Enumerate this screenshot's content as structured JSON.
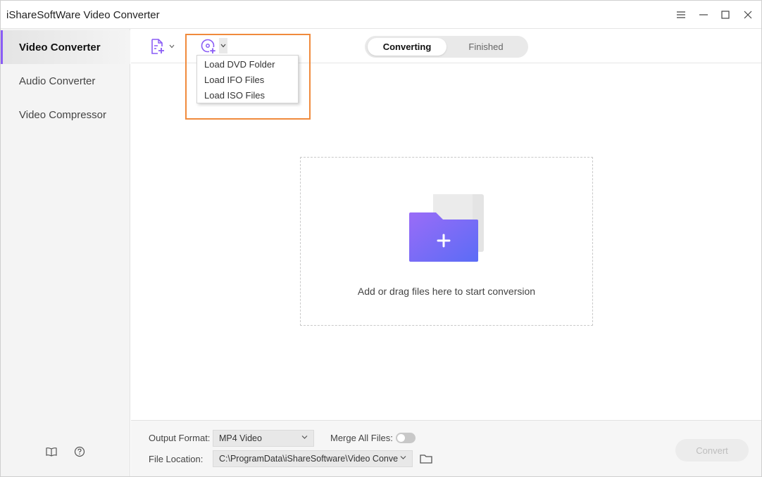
{
  "window": {
    "title": "iShareSoftWare Video Converter",
    "controls": [
      "menu-icon",
      "minimize-icon",
      "maximize-icon",
      "close-icon"
    ]
  },
  "sidebar": {
    "items": [
      {
        "label": "Video Converter",
        "active": true
      },
      {
        "label": "Audio Converter",
        "active": false
      },
      {
        "label": "Video Compressor",
        "active": false
      }
    ],
    "footer_icons": [
      "book-icon",
      "help-icon"
    ]
  },
  "toolbar": {
    "add_file_icon": "add-file-icon",
    "load_dvd_icon": "dvd-disc-icon",
    "tabs": [
      {
        "label": "Converting",
        "active": true
      },
      {
        "label": "Finished",
        "active": false
      }
    ]
  },
  "dvd_menu": {
    "items": [
      "Load DVD Folder",
      "Load IFO Files",
      "Load ISO Files"
    ]
  },
  "drop_zone": {
    "text": "Add or drag files here to start conversion"
  },
  "bottom": {
    "output_format_label": "Output Format:",
    "output_format_value": "MP4 Video",
    "merge_label": "Merge All Files:",
    "merge_enabled": false,
    "file_location_label": "File Location:",
    "file_location_value": "C:\\ProgramData\\iShareSoftware\\Video Conve",
    "convert_label": "Convert"
  },
  "colors": {
    "accent_purple": "#8a5cf5",
    "folder_gradient_start": "#9a6cf7",
    "folder_gradient_end": "#5b6cf6",
    "highlight_orange": "#f08a3c"
  }
}
